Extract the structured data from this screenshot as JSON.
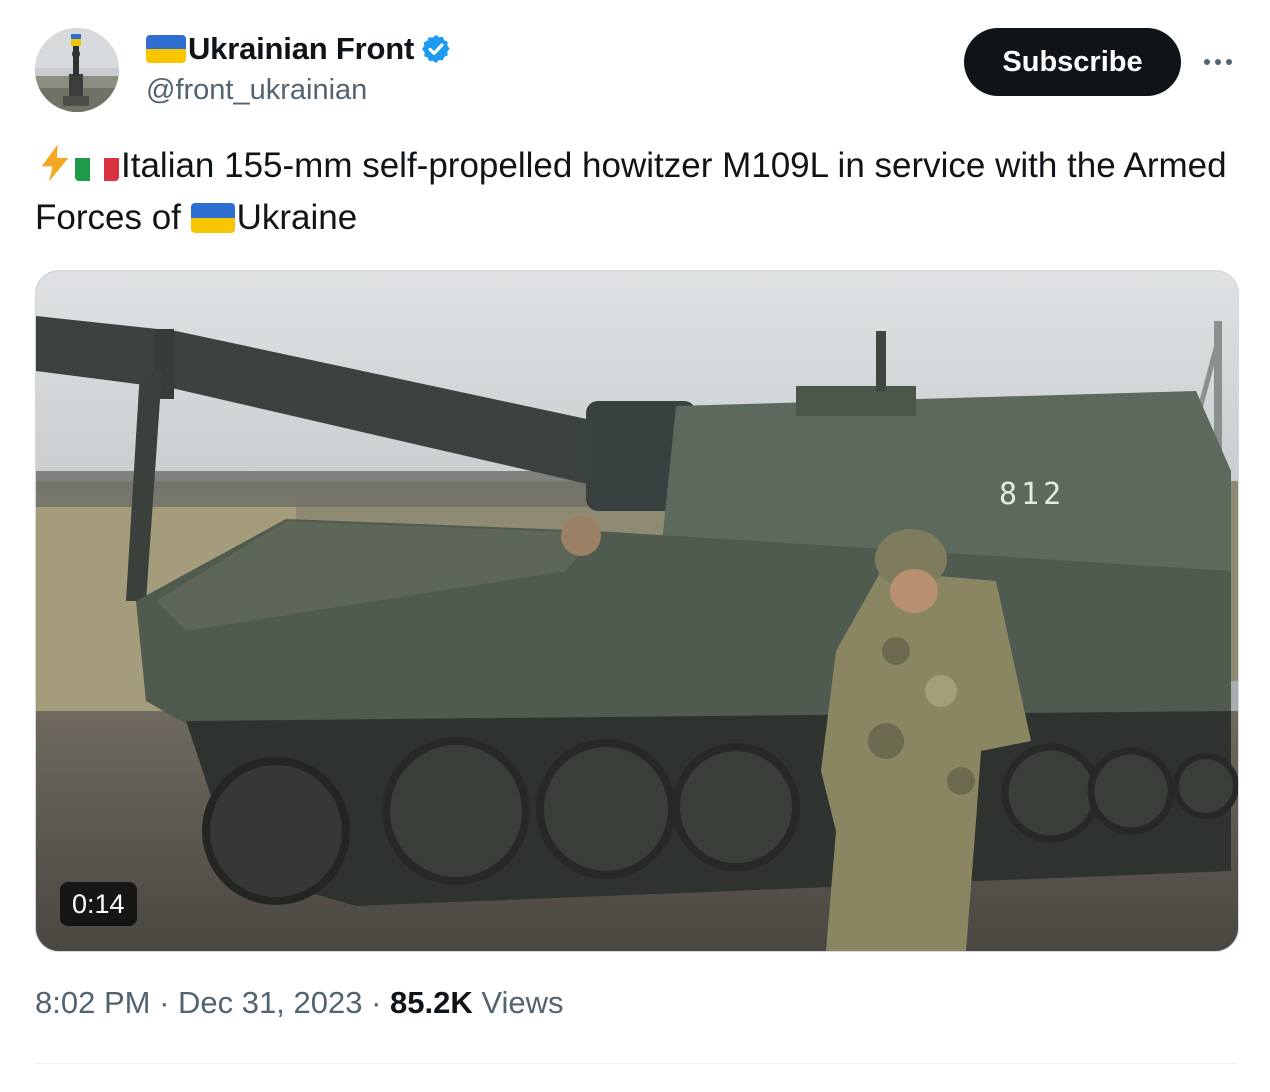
{
  "author": {
    "display_name": "Ukrainian Front",
    "handle": "@front_ukrainian",
    "verified": true,
    "flag_colors": [
      "#2f6fd1",
      "#f7c600"
    ]
  },
  "header": {
    "subscribe_label": "Subscribe",
    "more_icon": "more-horizontal-icon"
  },
  "tweet": {
    "text_part1": "Italian 155-mm self-propelled howitzer M109L in service with the Armed Forces of ",
    "text_part2": "Ukraine",
    "emojis": [
      "lightning-icon",
      "italy-flag-icon",
      "ukraine-flag-icon"
    ]
  },
  "media": {
    "type": "video",
    "duration": "0:14",
    "vehicle_number": "812"
  },
  "meta": {
    "time": "8:02 PM",
    "separator": "·",
    "date": "Dec 31, 2023",
    "views_count": "85.2K",
    "views_label": "Views"
  },
  "colors": {
    "text_primary": "#0f1419",
    "text_secondary": "#536471",
    "verified_blue": "#1d9bf0",
    "button_bg": "#0f1419"
  }
}
